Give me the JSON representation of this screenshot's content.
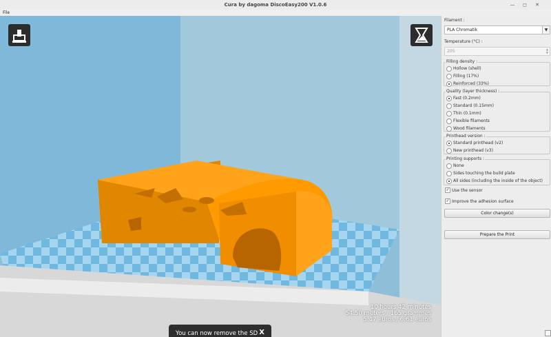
{
  "window": {
    "title": "Cura by dagoma DiscoEasy200 V1.0.6"
  },
  "menu": {
    "file": "File"
  },
  "viewport": {
    "stats": [
      "10 hours 42 minutes",
      "54.50 meters / 165 grammes",
      "5.47 euros / 6.61 euros"
    ],
    "toast": {
      "message": "You can now remove the SD card.",
      "close": "X"
    },
    "load_icon": "load-model-icon",
    "view_icon": "view-mode-icon",
    "colors": {
      "model": "#ff9a00",
      "bed_light": "#a6d6ef",
      "bed_dark": "#6fb9e1"
    }
  },
  "panel": {
    "filament_label": "Filament :",
    "filament_value": "PLA Chromatik",
    "temperature_label": "Temperature (°C) :",
    "temperature_value": "205",
    "filling": {
      "title": "Filling density :",
      "options": [
        {
          "label": "Hollow (shell)",
          "selected": false
        },
        {
          "label": "Filling (17%)",
          "selected": false
        },
        {
          "label": "Reinforced  (33%)",
          "selected": true
        }
      ]
    },
    "quality": {
      "title": "Quality (layer thickness) :",
      "options": [
        {
          "label": "Fast (0.2mm)",
          "selected": true
        },
        {
          "label": "Standard (0.15mm)",
          "selected": false
        },
        {
          "label": "Thin (0.1mm)",
          "selected": false
        },
        {
          "label": "Flexible filaments",
          "selected": false
        },
        {
          "label": "Wood filaments",
          "selected": false
        }
      ]
    },
    "printhead": {
      "title": "Printhead version :",
      "options": [
        {
          "label": "Standard printhead (v2)",
          "selected": true
        },
        {
          "label": "New printhead (v3)",
          "selected": false
        }
      ]
    },
    "supports": {
      "title": "Printing supports :",
      "options": [
        {
          "label": "None",
          "selected": false
        },
        {
          "label": "Sides touching the build plate",
          "selected": false
        },
        {
          "label": "All sides (including the inside of the object)",
          "selected": true
        }
      ]
    },
    "use_sensor": {
      "label": "Use the sensor",
      "checked": true
    },
    "adhesion": {
      "label": "Improve the adhesion surface",
      "checked": true
    },
    "color_change_button": "Color change(s)",
    "prepare_button": "Prepare the Print"
  }
}
